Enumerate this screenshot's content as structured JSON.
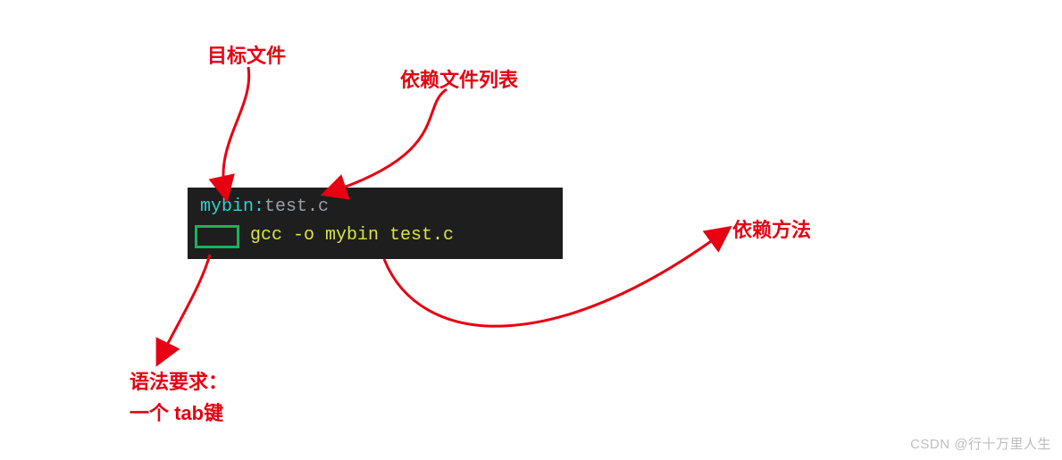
{
  "labels": {
    "target_file": "目标文件",
    "dep_list": "依赖文件列表",
    "dep_method": "依赖方法",
    "tab_req_line1": "语法要求：",
    "tab_req_line2": "一个 tab键"
  },
  "code": {
    "target": "mybin",
    "colon": ":",
    "dependency": "test.c",
    "command": "gcc -o mybin test.c"
  },
  "colors": {
    "annotation_red": "#e60012",
    "terminal_bg": "#1e1e1e",
    "target_cyan": "#2bd4d0",
    "dep_gray": "#9aa0a6",
    "cmd_yellow": "#d9e24a",
    "tab_box_green": "#18b35a"
  },
  "watermark": "CSDN @行十万里人生"
}
